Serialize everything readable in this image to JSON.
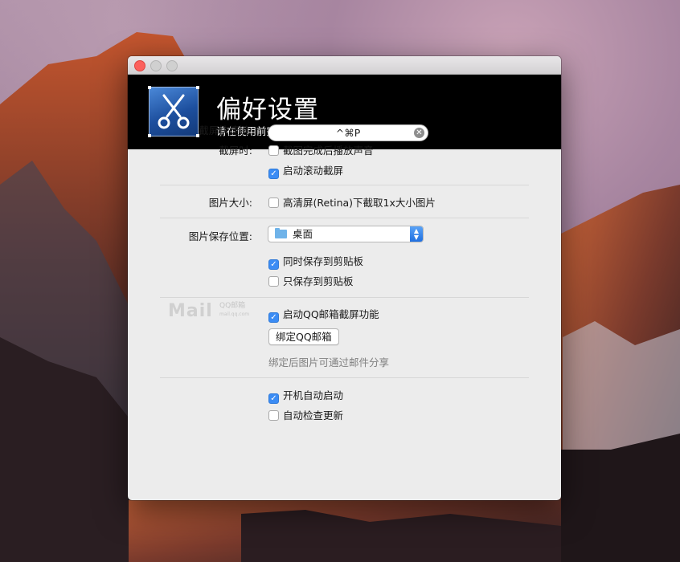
{
  "window": {
    "banner_title": "偏好设置",
    "banner_subtitle": "请在使用前完成以下设置"
  },
  "screenshot_section": {
    "hotkey_label": "截屏快捷键:",
    "hotkey_value": "^⌘P",
    "on_capture_label": "截屏时:",
    "play_sound": {
      "label": "截图完成后播放声音",
      "checked": false
    },
    "scroll_capture": {
      "label": "启动滚动截屏",
      "checked": true
    }
  },
  "image_size_section": {
    "label": "图片大小:",
    "retina_small": {
      "label": "高清屏(Retina)下截取1x大小图片",
      "checked": false
    }
  },
  "save_location_section": {
    "label": "图片保存位置:",
    "folder_selected": "桌面",
    "also_clipboard": {
      "label": "同时保存到剪贴板",
      "checked": true
    },
    "only_clipboard": {
      "label": "只保存到剪贴板",
      "checked": false
    }
  },
  "qqmail_section": {
    "logo_text": "Mail",
    "logo_sub": "QQ邮箱",
    "logo_url": "mail.qq.com",
    "enable": {
      "label": "启动QQ邮箱截屏功能",
      "checked": true
    },
    "bind_button": "绑定QQ邮箱",
    "hint": "绑定后图片可通过邮件分享"
  },
  "startup_section": {
    "launch_at_login": {
      "label": "开机自动启动",
      "checked": true
    },
    "auto_update": {
      "label": "自动检查更新",
      "checked": false
    }
  },
  "icons": {
    "app": "scissors-icon",
    "folder": "folder-icon",
    "clear": "clear-icon",
    "stepper": "updown-chevron-icon"
  },
  "colors": {
    "accent": "#3b8cf4",
    "close_button": "#fc605c",
    "banner": "#000000"
  }
}
